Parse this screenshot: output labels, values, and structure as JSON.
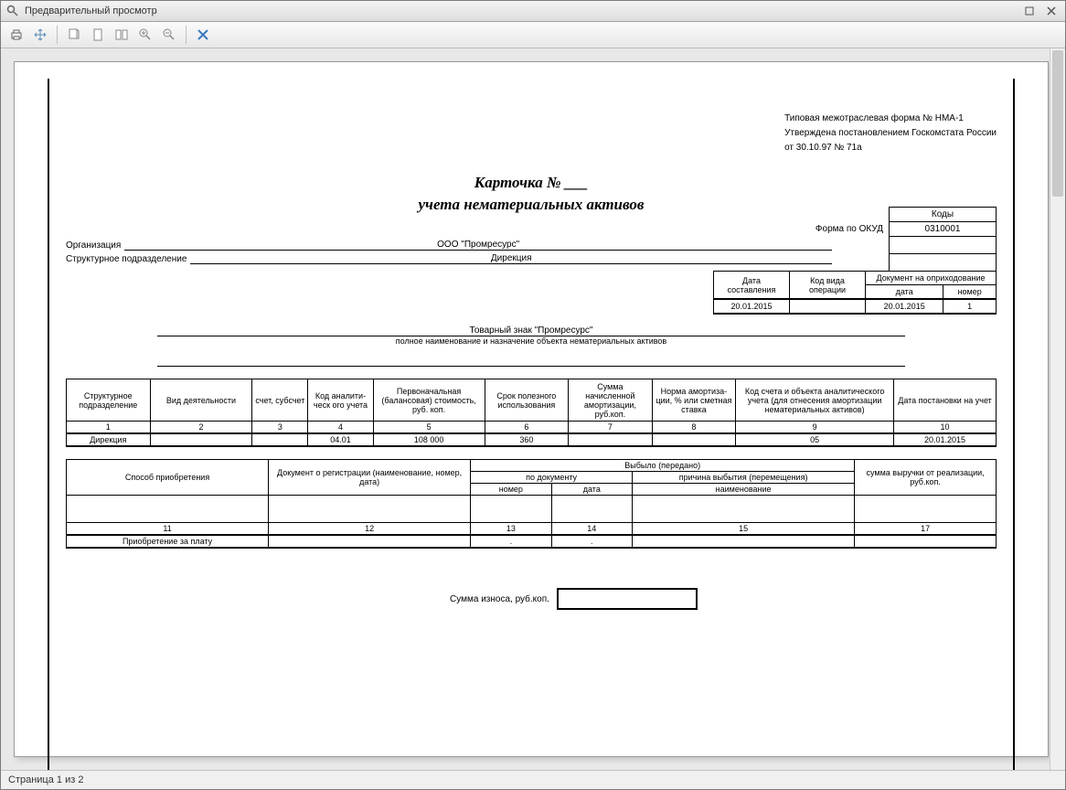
{
  "window": {
    "title": "Предварительный просмотр"
  },
  "toolbar_icons": {
    "print": "print-icon",
    "cross": "move-icon",
    "page_fit": "page-fit-icon",
    "page_one": "page-one-icon",
    "page_multi": "page-multi-icon",
    "zoom_in": "zoom-in-icon",
    "zoom_out": "zoom-out-icon",
    "close_doc": "close-doc-icon"
  },
  "form_header": {
    "line1": "Типовая межотраслевая форма № НМА-1",
    "line2": "Утверждена постановлением Госкомстата России",
    "line3": "от 30.10.97 № 71а"
  },
  "doc_title": {
    "l1": "Карточка  № ___",
    "l2": "учета нематериальных активов"
  },
  "codes": {
    "header": "Коды",
    "okud_label": "Форма по ОКУД",
    "okud_value": "0310001"
  },
  "org": {
    "org_label": "Организация",
    "org_value": "ООО \"Промресурс\"",
    "dept_label": "Структурное подразделение",
    "dept_value": "Дирекция"
  },
  "header_table": {
    "date_label": "Дата составления",
    "op_label": "Код вида операции",
    "doc_label": "Документ на оприходование",
    "sub_date": "дата",
    "sub_num": "номер",
    "date_val": "20.01.2015",
    "op_val": "",
    "doc_date_val": "20.01.2015",
    "doc_num_val": "1"
  },
  "tm": {
    "name": "Товарный знак \"Промресурс\"",
    "cap": "полное наименование и назначение объекта нематериальных активов"
  },
  "main_cols": [
    "Структурное подразделение",
    "Вид деятельности",
    "счет, субсчет",
    "Код аналити-ческ ого учета",
    "Первоначальная (балансовая) стоимость, руб. коп.",
    "Срок полезного использования",
    "Сумма начисленной амортизации, руб.коп.",
    "Норма амортиза-ции, % или сметная ставка",
    "Код счета и объекта аналитического учета (для отнесения амортизации нематериальных активов)",
    "Дата постановки на учет"
  ],
  "main_nums": [
    "1",
    "2",
    "3",
    "4",
    "5",
    "6",
    "7",
    "8",
    "9",
    "10"
  ],
  "main_row": [
    "Дирекция",
    "",
    "",
    "04.01",
    "108 000",
    "360",
    "",
    "",
    "05",
    "20.01.2015"
  ],
  "sec": {
    "acq": "Способ приобретения",
    "reg": "Документ о регистрации (наименование, номер, дата)",
    "out": "Выбыло (передано)",
    "bydoc": "по документу",
    "reason": "причина выбытия (перемещения)",
    "sum": "сумма выручки от реализации, руб.коп.",
    "num": "номер",
    "date": "дата",
    "name": "наименование"
  },
  "sec_nums": [
    "11",
    "12",
    "13",
    "14",
    "15",
    "17"
  ],
  "sec_row": [
    "Приобретение за плату",
    "",
    ".",
    ".",
    "",
    ""
  ],
  "wear": {
    "label": "Сумма износа, руб.коп."
  },
  "status": {
    "text": "Страница 1 из 2"
  }
}
